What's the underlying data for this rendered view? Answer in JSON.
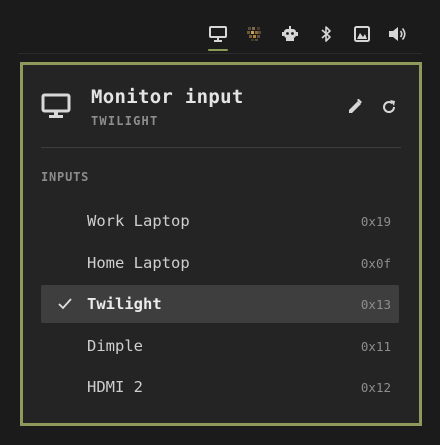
{
  "tray": {
    "items": [
      {
        "icon": "monitor-icon",
        "active": true
      },
      {
        "icon": "pixel-avatar-icon",
        "active": false
      },
      {
        "icon": "robot-icon",
        "active": false
      },
      {
        "icon": "bluetooth-icon",
        "active": false
      },
      {
        "icon": "image-icon",
        "active": false
      },
      {
        "icon": "volume-icon",
        "active": false
      }
    ]
  },
  "panel": {
    "title": "Monitor input",
    "subtitle": "TWILIGHT",
    "icon": "monitor-icon",
    "actions": [
      {
        "icon": "edit-icon"
      },
      {
        "icon": "refresh-icon"
      }
    ],
    "section_label": "INPUTS",
    "inputs": [
      {
        "name": "Work Laptop",
        "code": "0x19",
        "selected": false
      },
      {
        "name": "Home Laptop",
        "code": "0x0f",
        "selected": false
      },
      {
        "name": "Twilight",
        "code": "0x13",
        "selected": true
      },
      {
        "name": "Dimple",
        "code": "0x11",
        "selected": false
      },
      {
        "name": "HDMI 2",
        "code": "0x12",
        "selected": false
      }
    ]
  },
  "colors": {
    "accent": "#8e9a5c",
    "background": "#1b1b1b",
    "panel_bg": "#242424",
    "selected_row": "#3e3e3e"
  }
}
